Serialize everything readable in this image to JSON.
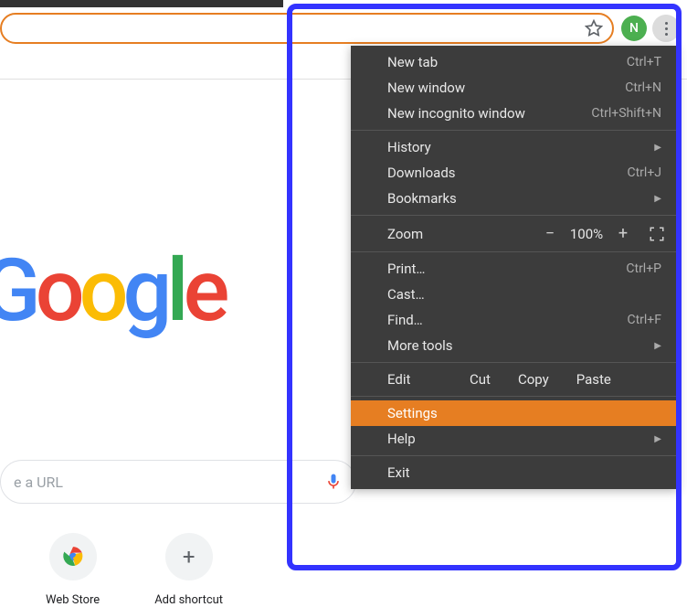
{
  "omnibox": {
    "avatar_letter": "N"
  },
  "page": {
    "search_placeholder": "e a URL",
    "shortcuts": {
      "webstore": "Web Store",
      "add": "Add shortcut"
    }
  },
  "menu": {
    "section1": [
      {
        "label": "New tab",
        "shortcut": "Ctrl+T"
      },
      {
        "label": "New window",
        "shortcut": "Ctrl+N"
      },
      {
        "label": "New incognito window",
        "shortcut": "Ctrl+Shift+N"
      }
    ],
    "section2": {
      "history": "History",
      "downloads": {
        "label": "Downloads",
        "shortcut": "Ctrl+J"
      },
      "bookmarks": "Bookmarks"
    },
    "zoom": {
      "label": "Zoom",
      "value": "100%",
      "minus": "−",
      "plus": "+"
    },
    "section3": {
      "print": {
        "label": "Print…",
        "shortcut": "Ctrl+P"
      },
      "cast": "Cast…",
      "find": {
        "label": "Find…",
        "shortcut": "Ctrl+F"
      },
      "moretools": "More tools"
    },
    "edit": {
      "label": "Edit",
      "cut": "Cut",
      "copy": "Copy",
      "paste": "Paste"
    },
    "settings": "Settings",
    "help": "Help",
    "exit": "Exit"
  }
}
